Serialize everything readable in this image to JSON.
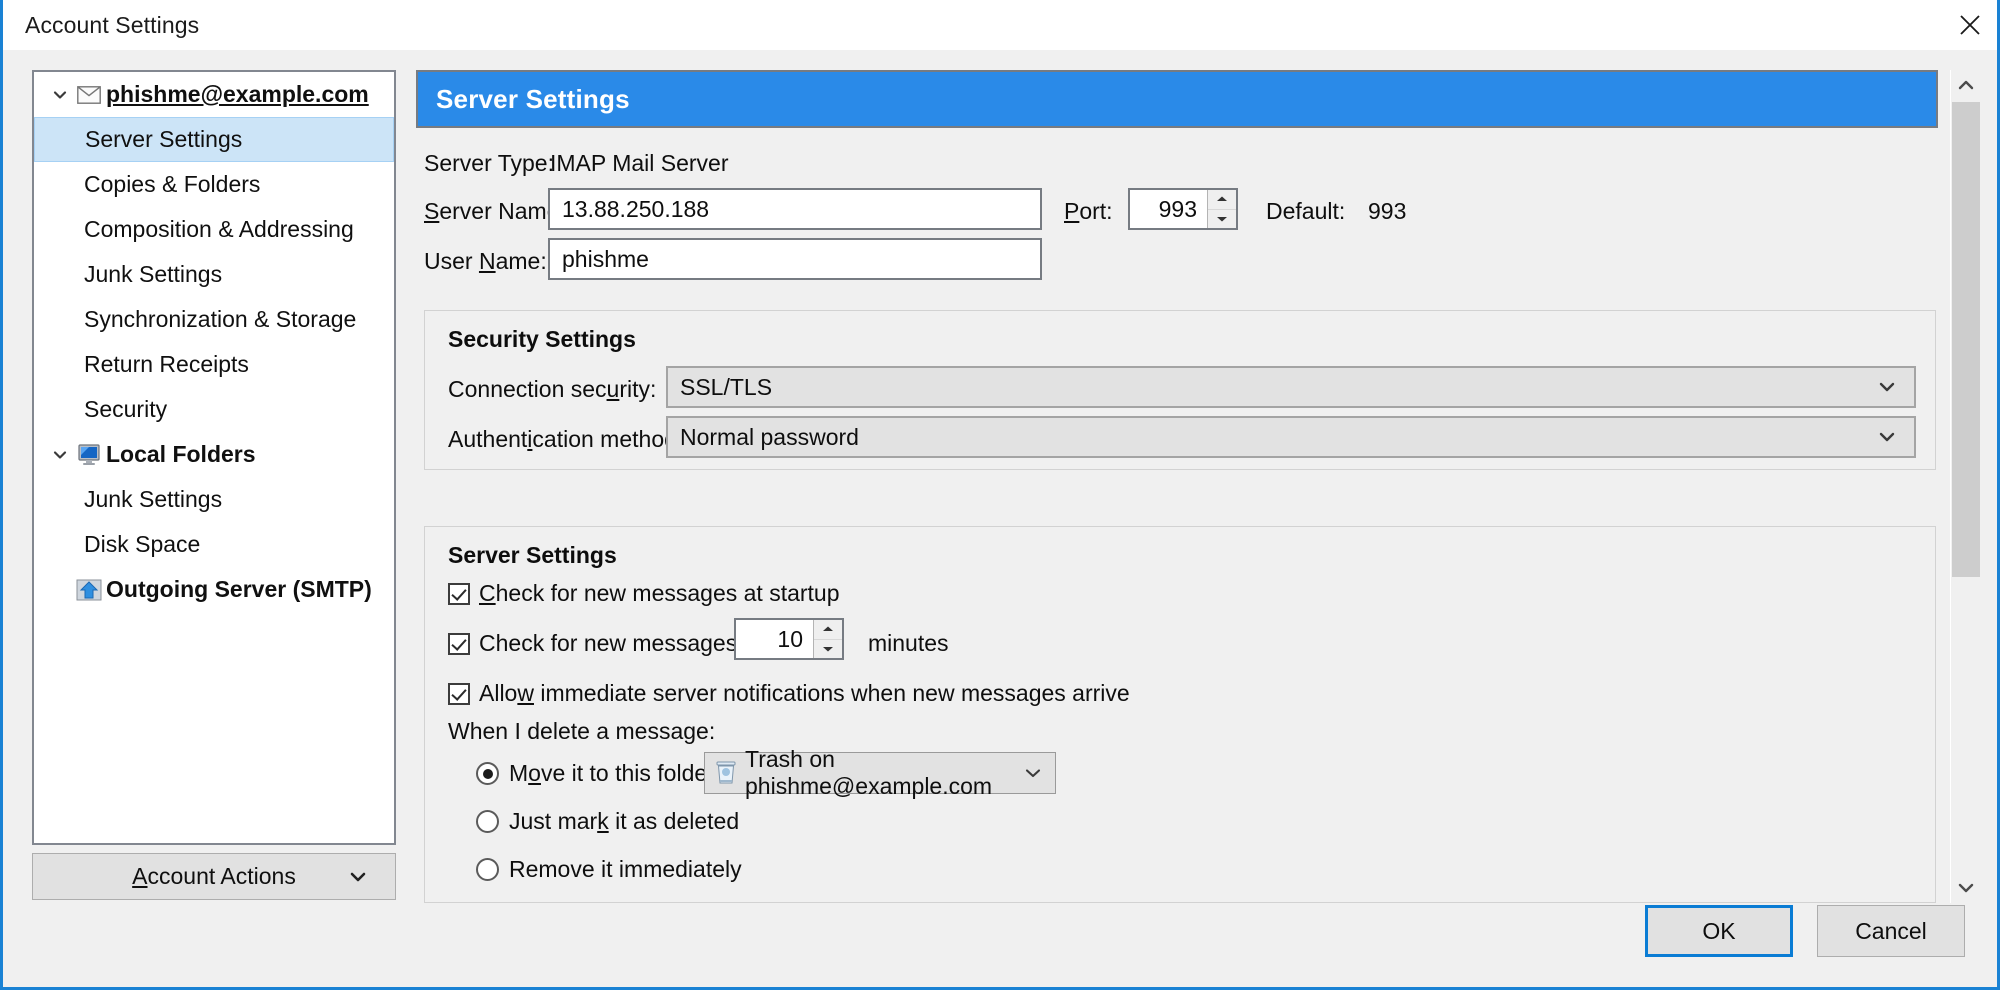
{
  "window": {
    "title": "Account Settings",
    "close_icon": "close-x-icon",
    "accent_color": "#1a82d4"
  },
  "sidebar": {
    "items": [
      {
        "label": "phishme@example.com",
        "icon": "envelope-icon",
        "level": 0,
        "style": "bold-link",
        "twisty": "chevron-down-icon",
        "selected": false
      },
      {
        "label": "Server Settings",
        "icon": "",
        "level": 1,
        "style": "plain",
        "twisty": "",
        "selected": true
      },
      {
        "label": "Copies & Folders",
        "icon": "",
        "level": 1,
        "style": "plain",
        "twisty": "",
        "selected": false
      },
      {
        "label": "Composition & Addressing",
        "icon": "",
        "level": 1,
        "style": "plain",
        "twisty": "",
        "selected": false
      },
      {
        "label": "Junk Settings",
        "icon": "",
        "level": 1,
        "style": "plain",
        "twisty": "",
        "selected": false
      },
      {
        "label": "Synchronization & Storage",
        "icon": "",
        "level": 1,
        "style": "plain",
        "twisty": "",
        "selected": false
      },
      {
        "label": "Return Receipts",
        "icon": "",
        "level": 1,
        "style": "plain",
        "twisty": "",
        "selected": false
      },
      {
        "label": "Security",
        "icon": "",
        "level": 1,
        "style": "plain",
        "twisty": "",
        "selected": false
      },
      {
        "label": "Local Folders",
        "icon": "computer-icon",
        "level": 0,
        "style": "bold-plain",
        "twisty": "chevron-down-icon",
        "selected": false
      },
      {
        "label": "Junk Settings",
        "icon": "",
        "level": 1,
        "style": "plain",
        "twisty": "",
        "selected": false
      },
      {
        "label": "Disk Space",
        "icon": "",
        "level": 1,
        "style": "plain",
        "twisty": "",
        "selected": false
      },
      {
        "label": "Outgoing Server (SMTP)",
        "icon": "outgoing-server-icon",
        "level": 1,
        "style": "bold-plain",
        "twisty": "",
        "selected": false
      }
    ],
    "account_actions": {
      "label_before": "A",
      "label_accel": "A",
      "label": "Account Actions",
      "caret_icon": "chevron-down-icon"
    }
  },
  "main": {
    "section_header": "Server Settings",
    "server_type": {
      "label": "Server Type:",
      "value": "IMAP Mail Server"
    },
    "server_name": {
      "label": "Server Name:",
      "accel": "S",
      "value": "13.88.250.188"
    },
    "port": {
      "label": "Port:",
      "accel": "P",
      "value": "993",
      "default_label": "Default:",
      "default_value": "993"
    },
    "user_name": {
      "label": "User Name:",
      "accel": "N",
      "value": "phishme"
    },
    "security_group": {
      "heading": "Security Settings",
      "connection_security": {
        "label": "Connection security:",
        "accel": "u",
        "value": "SSL/TLS",
        "caret_icon": "chevron-down-icon"
      },
      "authentication_method": {
        "label": "Authentication method:",
        "accel": "i",
        "value": "Normal password",
        "caret_icon": "chevron-down-icon"
      }
    },
    "server_group": {
      "heading": "Server Settings",
      "check_startup": {
        "label": "Check for new messages at startup",
        "accel": "C",
        "checked": true
      },
      "check_every": {
        "label": "Check for new messages every",
        "checked": true,
        "value": "10",
        "unit": "minutes"
      },
      "allow_notifications": {
        "label": "Allow immediate server notifications when new messages arrive",
        "checked": true
      },
      "delete_group_label": "When I delete a message:",
      "delete_options": [
        {
          "label": "Move it to this folder:",
          "selected": true
        },
        {
          "label": "Just mark it as deleted",
          "selected": false
        },
        {
          "label": "Remove it immediately",
          "selected": false
        }
      ],
      "trash_folder": {
        "value": "Trash on phishme@example.com",
        "icon": "trash-icon",
        "caret_icon": "chevron-down-icon"
      }
    }
  },
  "scrollbar": {
    "up_icon": "chevron-up-icon",
    "down_icon": "chevron-down-icon"
  },
  "footer": {
    "ok": "OK",
    "cancel": "Cancel"
  }
}
